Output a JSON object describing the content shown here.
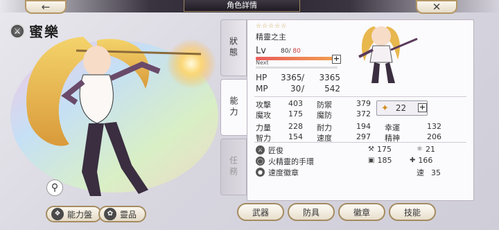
{
  "header": {
    "title": "角色詳情",
    "back_icon": "arrow-left-icon",
    "close_icon": "close-icon"
  },
  "character": {
    "name": "蜜樂",
    "weapon_type_icon": "sword-icon"
  },
  "art_buttons": {
    "zoom_icon": "magnify-icon",
    "ability_board": "能力盤",
    "spirit": "靈品"
  },
  "side_tabs": [
    {
      "label": "狀態",
      "state": "inactive"
    },
    {
      "label": "能力",
      "state": "active"
    },
    {
      "label": "任務",
      "state": "disabled"
    }
  ],
  "status": {
    "stars": "☆☆☆☆☆",
    "title": "精靈之主",
    "lv_label": "Lv",
    "lv_current": "80",
    "lv_slash": "/",
    "lv_max": "80",
    "lv_progress": 1.0,
    "next_label": "Next",
    "next_progress": 0.0,
    "hp": {
      "label": "HP",
      "current": "3365",
      "sep": "/",
      "max": "3365"
    },
    "mp": {
      "label": "MP",
      "current": "30",
      "sep": "/",
      "max": "542"
    }
  },
  "stats": [
    {
      "label": "攻擊",
      "value": "403"
    },
    {
      "label": "防禦",
      "value": "379"
    },
    {
      "label": "魔攻",
      "value": "175"
    },
    {
      "label": "魔防",
      "value": "372"
    },
    {
      "label": "力量",
      "value": "228"
    },
    {
      "label": "耐力",
      "value": "194"
    },
    {
      "label": "幸運",
      "value": "132"
    },
    {
      "label": "智力",
      "value": "154"
    },
    {
      "label": "速度",
      "value": "297"
    },
    {
      "label": "精神",
      "value": "206"
    }
  ],
  "wing_badge": {
    "value": "22",
    "icon": "wing-icon"
  },
  "equipment": [
    {
      "icon": "sword-icon",
      "name": "匠俊",
      "stat1_icon": "sword-small-icon",
      "stat1": "175",
      "stat2_icon": "wand-icon",
      "stat2": "21"
    },
    {
      "icon": "ring-icon",
      "name": "火精靈的手環",
      "stat1_icon": "armor-icon",
      "stat1": "185",
      "stat2_icon": "shield-icon",
      "stat2": "166"
    },
    {
      "icon": "medal-icon",
      "name": "速度徽章",
      "stat1_icon": "",
      "stat1": "",
      "stat2_label": "速",
      "stat2": "35"
    }
  ],
  "bottom_tabs": [
    "武器",
    "防具",
    "徽章",
    "技能"
  ]
}
